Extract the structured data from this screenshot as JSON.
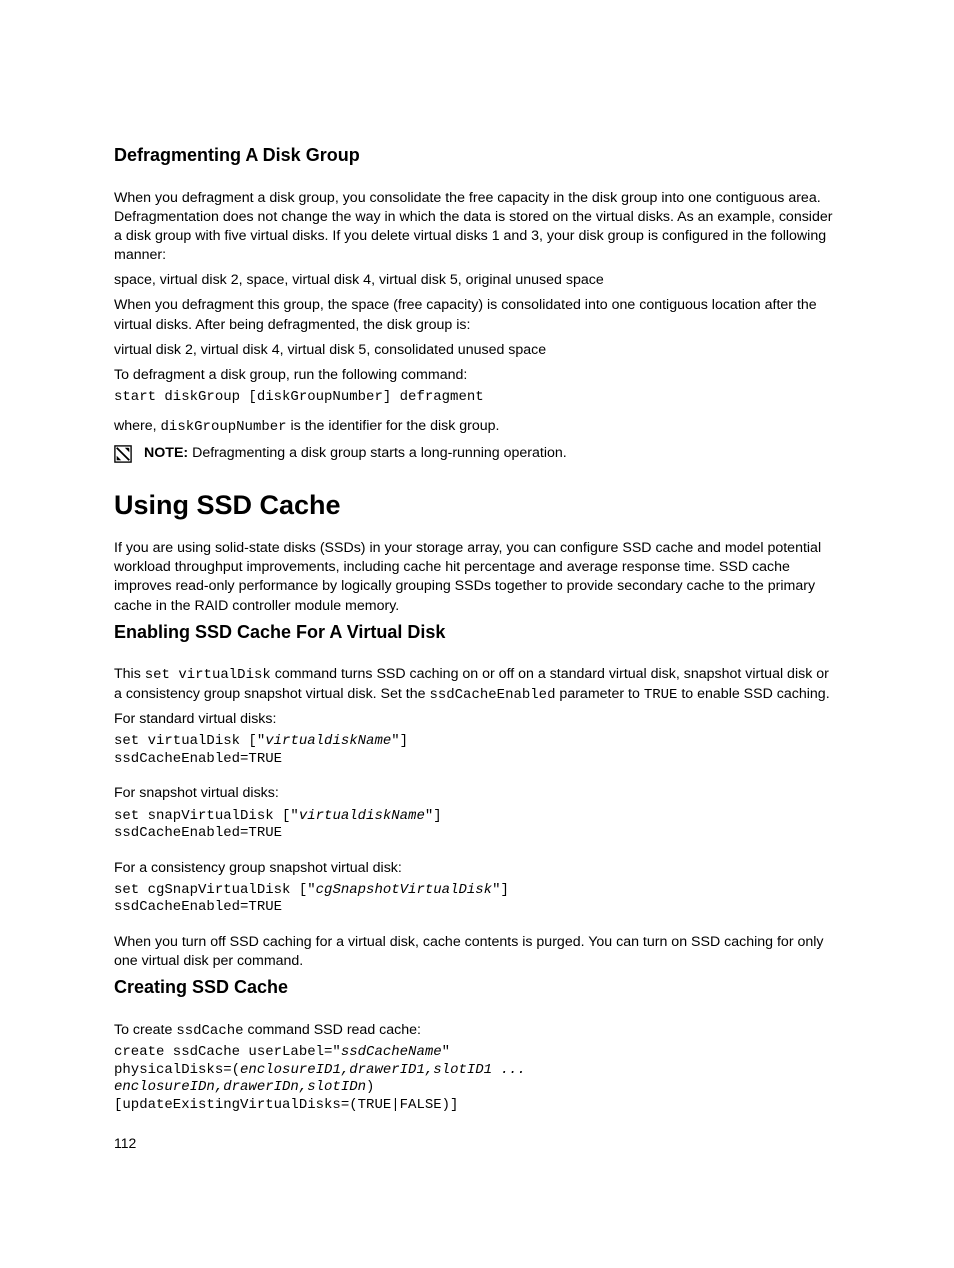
{
  "sections": {
    "defrag": {
      "heading": "Defragmenting A Disk Group",
      "p1": "When you defragment a disk group, you consolidate the free capacity in the disk group into one contiguous area. Defragmentation does not change the way in which the data is stored on the virtual disks. As an example, consider a disk group with five virtual disks. If you delete virtual disks 1 and 3, your disk group is configured in the following manner:",
      "p2": "space, virtual disk 2, space, virtual disk 4, virtual disk 5, original unused space",
      "p3": "When you defragment this group, the space (free capacity) is consolidated into one contiguous location after the virtual disks. After being defragmented, the disk group is:",
      "p4": "virtual disk 2, virtual disk 4, virtual disk 5, consolidated unused space",
      "p5": "To defragment a disk group, run the following command:",
      "code1": "start diskGroup [diskGroupNumber] defragment",
      "where_pre": "where, ",
      "where_code": "diskGroupNumber",
      "where_post": " is the identifier for the disk group.",
      "note_label": "NOTE: ",
      "note_text": "Defragmenting a disk group starts a long-running operation."
    },
    "ssd_main": {
      "heading": "Using SSD Cache",
      "p1": "If you are using solid-state disks (SSDs) in your storage array, you can configure SSD cache and model potential workload throughput improvements, including cache hit percentage and average response time. SSD cache improves read-only performance by logically grouping SSDs together to provide secondary cache to the primary cache in the RAID controller module memory."
    },
    "enable": {
      "heading": "Enabling SSD Cache For A Virtual Disk",
      "intro_1": "This ",
      "intro_code1": "set virtualDisk",
      "intro_2": " command turns SSD caching on or off on a standard virtual disk, snapshot virtual disk or a consistency group snapshot virtual disk. Set the ",
      "intro_code2": "ssdCacheEnabled",
      "intro_3": " parameter to ",
      "intro_code3": "TRUE",
      "intro_4": " to enable SSD caching.",
      "lbl1": "For standard virtual disks:",
      "code1a": "set virtualDisk [\"",
      "code1b": "virtualdiskName",
      "code1c": "\"]",
      "code1d": "ssdCacheEnabled=TRUE",
      "lbl2": "For snapshot virtual disks:",
      "code2a": "set snapVirtualDisk [\"",
      "code2b": "virtualdiskName",
      "code2c": "\"]",
      "code2d": "ssdCacheEnabled=TRUE",
      "lbl3": "For a consistency group snapshot virtual disk:",
      "code3a": "set cgSnapVirtualDisk [\"",
      "code3b": "cgSnapshotVirtualDisk",
      "code3c": "\"]",
      "code3d": "ssdCacheEnabled=TRUE",
      "outro": "When you turn off SSD caching for a virtual disk, cache contents is purged. You can turn on SSD caching for only one virtual disk per command."
    },
    "create": {
      "heading": "Creating SSD Cache",
      "intro_1": "To create ",
      "intro_code": "ssdCache",
      "intro_2": " command SSD read cache:",
      "c1a": "create ssdCache userLabel=\"",
      "c1b": "ssdCacheName",
      "c1c": "\"",
      "c2a": "physicalDisks=(",
      "c2b": "enclosureID1,drawerID1,slotID1 ...",
      "c3b": "enclosureIDn,drawerIDn,slotIDn",
      "c3c": ")",
      "c4": "[updateExistingVirtualDisks=(TRUE|FALSE)]"
    }
  },
  "page_number": "112"
}
